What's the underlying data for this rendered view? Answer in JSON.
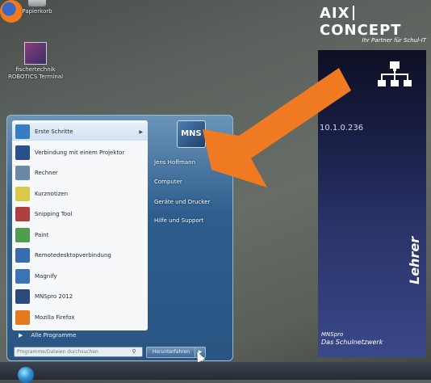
{
  "desktop": {
    "icons": [
      {
        "label": "Papierkorb",
        "icon": "recycle-bin-icon"
      },
      {
        "label": "fischertechnik\nROBOTICS Terminal",
        "icon": "robotics-terminal-icon"
      },
      {
        "label": "",
        "icon": "firefox-icon"
      }
    ]
  },
  "branding": {
    "logo_left": "AIX",
    "logo_right": "CONCEPT",
    "tagline": "Ihr Partner für Schul-IT"
  },
  "side_panel": {
    "network_icon": "network-tree-icon",
    "ip_address": "10.1.0.236",
    "role": "Lehrer",
    "product": "MNSpro",
    "product_tagline": "Das Schulnetzwerk"
  },
  "start_menu": {
    "programs": [
      {
        "label": "Erste Schritte",
        "icon": "getting-started-icon",
        "has_submenu": true,
        "color": "#3a7cc2"
      },
      {
        "label": "Verbindung mit einem Projektor",
        "icon": "projector-icon",
        "has_submenu": false,
        "color": "#2b4f8a"
      },
      {
        "label": "Rechner",
        "icon": "calculator-icon",
        "has_submenu": false,
        "color": "#6a88a8"
      },
      {
        "label": "Kurznotizen",
        "icon": "sticky-notes-icon",
        "has_submenu": false,
        "color": "#d9c94a"
      },
      {
        "label": "Snipping Tool",
        "icon": "scissors-icon",
        "has_submenu": false,
        "color": "#b04040"
      },
      {
        "label": "Paint",
        "icon": "paint-icon",
        "has_submenu": false,
        "color": "#4e9c4e"
      },
      {
        "label": "Remotedesktopverbindung",
        "icon": "remote-desktop-icon",
        "has_submenu": false,
        "color": "#3a6cb0"
      },
      {
        "label": "Magnify",
        "icon": "magnifier-icon",
        "has_submenu": false,
        "color": "#3b73b8"
      },
      {
        "label": "MNSpro 2012",
        "icon": "mnspro-icon",
        "has_submenu": false,
        "color": "#2c4a7a"
      },
      {
        "label": "Mozilla Firefox",
        "icon": "firefox-icon",
        "has_submenu": false,
        "color": "#e37a1f"
      }
    ],
    "all_programs": "Alle Programme",
    "search_placeholder": "Programme/Dateien durchsuchen",
    "user_picture_text": "MNS",
    "right_links": [
      {
        "label": "Jens Hoffmann"
      },
      {
        "label": "Computer"
      },
      {
        "label": "Geräte und Drucker"
      },
      {
        "label": "Hilfe und Support"
      }
    ],
    "shutdown_label": "Herunterfahren"
  },
  "overlay": {
    "arrow_color": "#f07a22"
  }
}
